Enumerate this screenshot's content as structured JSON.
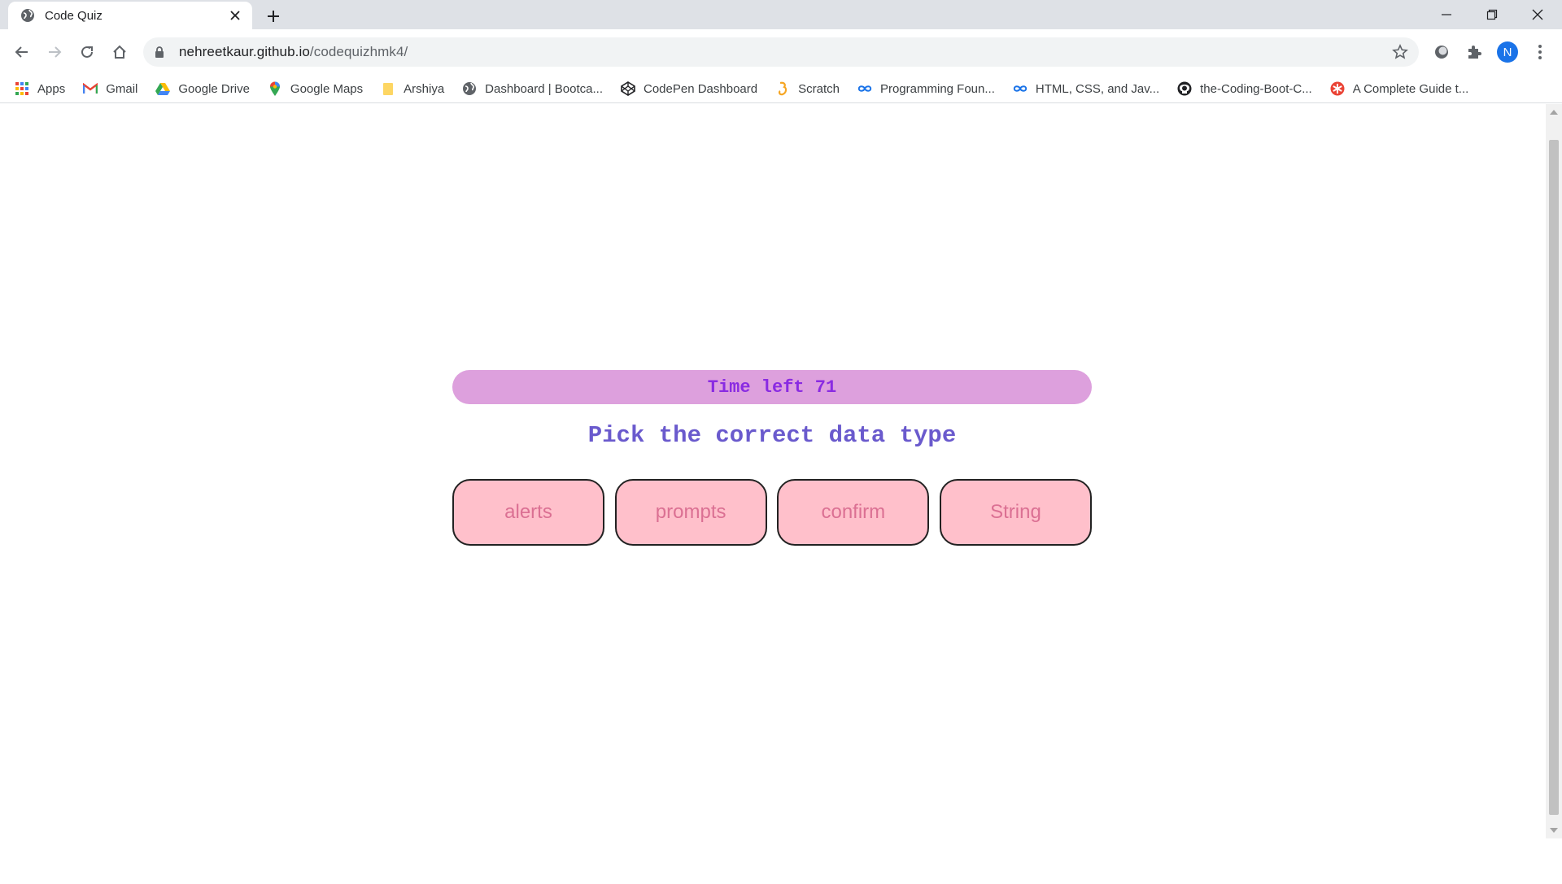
{
  "browser": {
    "tab": {
      "title": "Code Quiz",
      "favicon": "globe-icon"
    },
    "new_tab_icon": "plus-icon",
    "window_controls": [
      "minimize-icon",
      "restore-icon",
      "close-icon"
    ],
    "address": {
      "host": "nehreetkaur.github.io",
      "path": "/codequizhmk4/"
    },
    "profile_initial": "N",
    "bookmarks": [
      {
        "label": "Apps",
        "icon": "apps-grid-icon"
      },
      {
        "label": "Gmail",
        "icon": "gmail-icon"
      },
      {
        "label": "Google Drive",
        "icon": "google-drive-icon"
      },
      {
        "label": "Google Maps",
        "icon": "google-maps-icon"
      },
      {
        "label": "Arshiya",
        "icon": "folder-icon"
      },
      {
        "label": "Dashboard | Bootca...",
        "icon": "globe-icon"
      },
      {
        "label": "CodePen Dashboard",
        "icon": "codepen-icon"
      },
      {
        "label": "Scratch",
        "icon": "scratch-icon"
      },
      {
        "label": "Programming Foun...",
        "icon": "infinity-icon"
      },
      {
        "label": "HTML, CSS, and Jav...",
        "icon": "infinity-icon"
      },
      {
        "label": "the-Coding-Boot-C...",
        "icon": "github-icon"
      },
      {
        "label": "A Complete Guide t...",
        "icon": "asterisk-icon"
      }
    ],
    "colors": {
      "tabstrip": "#dee1e6",
      "omnibox": "#f1f3f4",
      "profile": "#1a73e8"
    }
  },
  "quiz": {
    "timer_text": "Time left 71",
    "question": "Pick the correct data type",
    "answers": [
      "alerts",
      "prompts",
      "confirm",
      "String"
    ],
    "colors": {
      "timer_bg": "#dda0dd",
      "timer_text": "#8a2be2",
      "question_text": "#6a5acd",
      "answer_bg": "#ffc0cb",
      "answer_text": "#db7093"
    }
  }
}
